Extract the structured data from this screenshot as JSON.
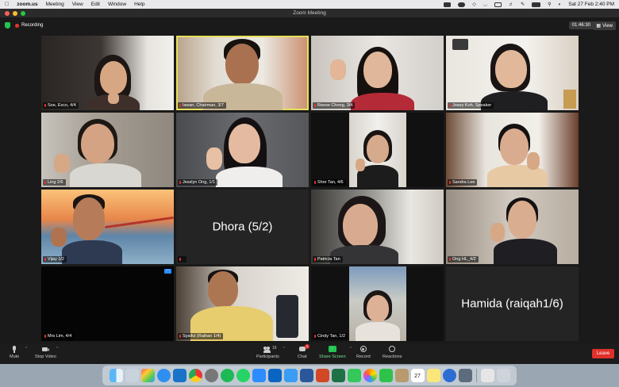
{
  "menubar": {
    "app": "zoom.us",
    "items": [
      "Meeting",
      "View",
      "Edit",
      "Window",
      "Help"
    ],
    "clock": "Sat 27 Feb  2:40 PM"
  },
  "window": {
    "title": "Zoom Meeting",
    "recording_label": "Recording",
    "timer": "01:46:30",
    "view_label": "View"
  },
  "participants": [
    {
      "name": "Soe, Exco, 4/4",
      "speaking": false
    },
    {
      "name": "Iswan, Chairman, 3/7",
      "speaking": true
    },
    {
      "name": "Reese Chong, 3/4",
      "speaking": false
    },
    {
      "name": "Josey Koh, Speaker",
      "speaking": false
    },
    {
      "name": "Ling 2/6",
      "speaking": false
    },
    {
      "name": "Jesslyn Ong, 1/1",
      "speaking": false
    },
    {
      "name": "Shre Tan, 4/6",
      "speaking": false
    },
    {
      "name": "Sandra Lee",
      "speaking": false
    },
    {
      "name": "Vijay 1/2",
      "speaking": false
    },
    {
      "name": "Dhora (5/2)",
      "speaking": false,
      "video_off": true
    },
    {
      "name": "Patricia Tan",
      "speaking": false
    },
    {
      "name": "Ong HL_4/2",
      "speaking": false
    },
    {
      "name": "Mrs Lim, 4/4",
      "speaking": false
    },
    {
      "name": "Syaiful (Raihan 1/4)",
      "speaking": false
    },
    {
      "name": "Cindy Tan, 1/2",
      "speaking": false
    },
    {
      "name": "Hamida (raiqah1/6)",
      "speaking": false,
      "video_off": true
    }
  ],
  "toolbar": {
    "mute": "Mute",
    "stop_video": "Stop Video",
    "participants": "Participants",
    "participants_count": "16",
    "chat": "Chat",
    "chat_badge": "1",
    "share_screen": "Share Screen",
    "record": "Record",
    "reactions": "Reactions",
    "leave": "Leave"
  },
  "dock": {
    "calendar_day": "27",
    "icons": [
      "finder-icon",
      "launchpad-icon",
      "app-grid-icon",
      "safari-icon",
      "onedrive-icon",
      "chrome-icon",
      "settings-icon",
      "spotify-icon",
      "whatsapp-icon",
      "zoom-icon",
      "outlook-icon",
      "mail-icon",
      "word-icon",
      "powerpoint-icon",
      "excel-icon",
      "messages-icon",
      "photos-icon",
      "facetime-icon",
      "contacts-icon",
      "calendar-icon",
      "notes-icon",
      "finder-blue-icon",
      "screen-icon",
      "preview-icon",
      "trash-icon"
    ]
  }
}
